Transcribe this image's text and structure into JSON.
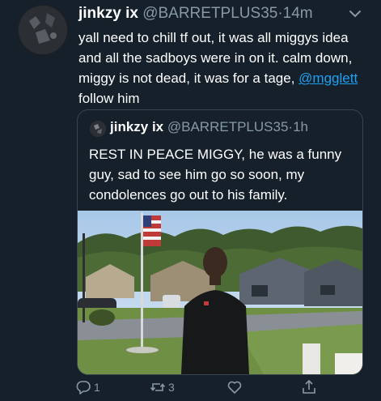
{
  "tweet": {
    "display_name": "jinkzy ix",
    "handle": "@BARRETPLUS35",
    "separator": "·",
    "time": "14m",
    "text_before": "yall need to chill tf out, it was all miggys idea and all the sadboys were in on it. calm down, miggy is not dead, it was for a tage, ",
    "mention": "@mgglett",
    "text_after": " follow him"
  },
  "quoted_tweet": {
    "display_name": "jinkzy ix",
    "handle": "@BARRETPLUS35",
    "separator": "·",
    "time": "1h",
    "text": "REST IN PEACE MIGGY, he was a funny guy, sad to see him go so soon, my condolences go out to his family."
  },
  "actions": {
    "reply_count": "1",
    "retweet_count": "3"
  },
  "icons": [
    "avatar",
    "chevron-down-icon",
    "reply-icon",
    "retweet-icon",
    "like-icon",
    "share-icon"
  ],
  "colors": {
    "background": "#15202b",
    "text": "#ffffff",
    "secondary": "#8899a6",
    "link": "#1da1f2",
    "border": "#38444d"
  }
}
